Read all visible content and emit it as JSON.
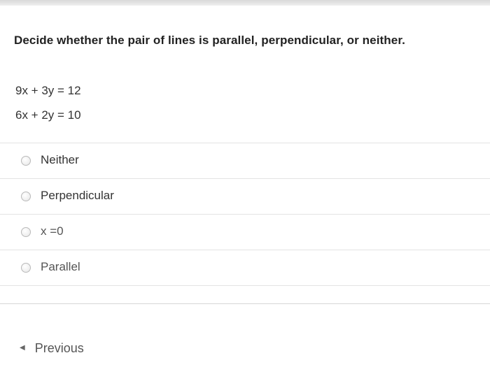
{
  "question": {
    "title": "Decide whether the pair of lines is parallel, perpendicular, or neither.",
    "equations": [
      "9x + 3y = 12",
      "6x + 2y = 10"
    ]
  },
  "options": [
    {
      "label": "Neither",
      "selected": false
    },
    {
      "label": "Perpendicular",
      "selected": false
    },
    {
      "label": "x =0",
      "selected": false
    },
    {
      "label": "Parallel",
      "selected": false
    }
  ],
  "navigation": {
    "previous_label": "Previous",
    "previous_icon": "chevron-left-icon"
  }
}
